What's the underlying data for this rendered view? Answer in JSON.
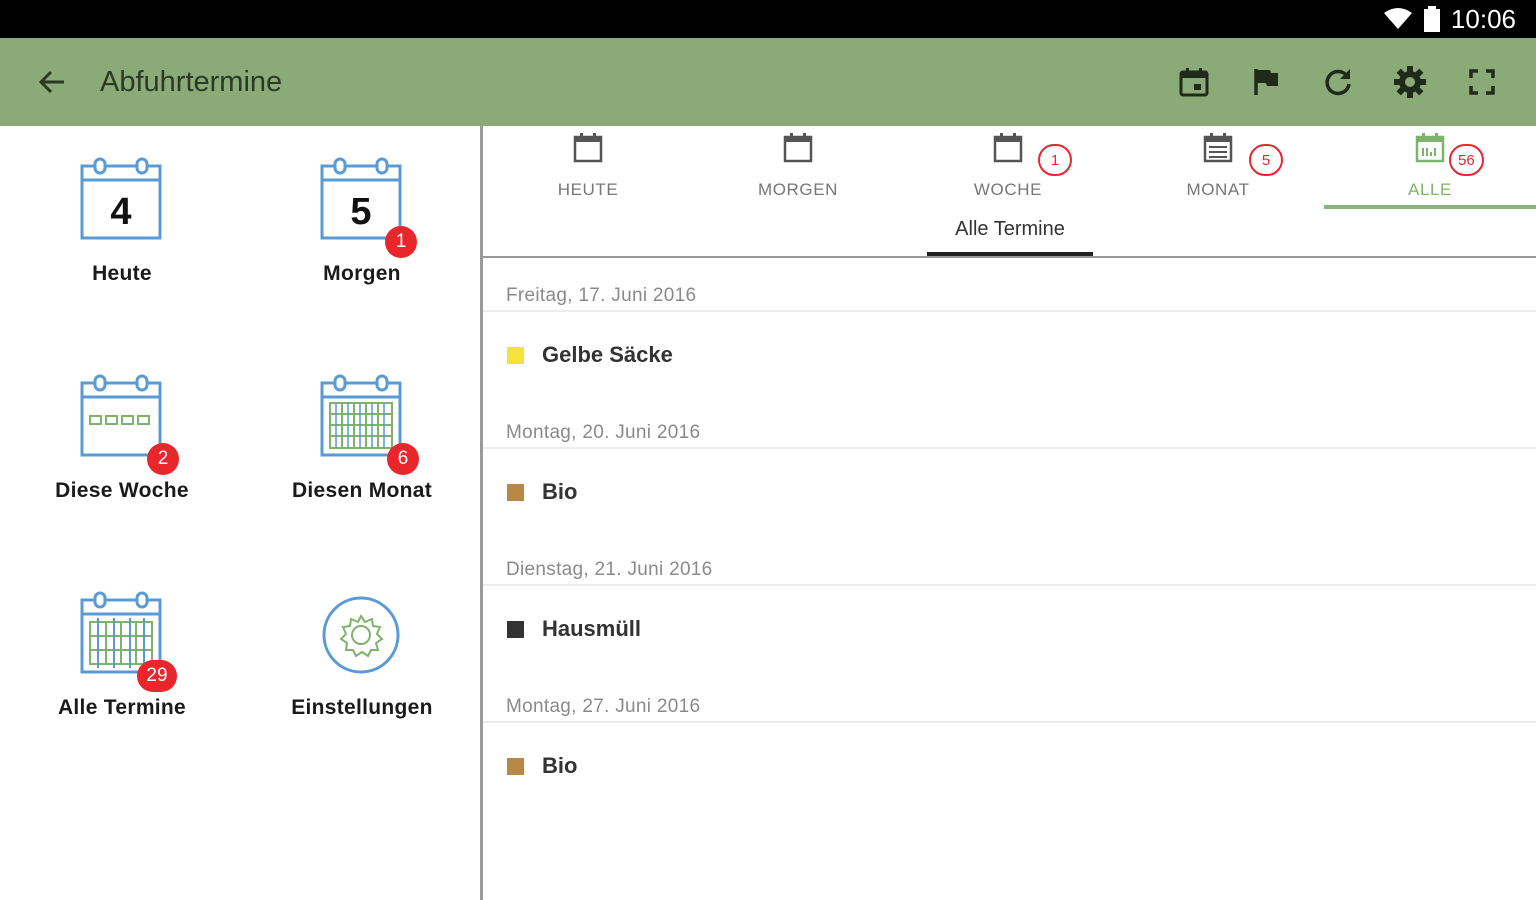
{
  "statusbar": {
    "time": "10:06",
    "icons": [
      "wifi-icon",
      "battery-icon"
    ]
  },
  "appbar": {
    "title": "Abfuhrtermine",
    "back_icon": "arrow-back-icon",
    "actions": [
      "calendar-today-icon",
      "flag-icon",
      "refresh-icon",
      "settings-icon",
      "fullscreen-icon"
    ],
    "color": "#8aab78"
  },
  "dashboard": {
    "tiles": [
      {
        "label": "Heute",
        "day": "4",
        "icon": "calendar-day-icon"
      },
      {
        "label": "Morgen",
        "day": "5",
        "badge": "1",
        "icon": "calendar-day-icon"
      },
      {
        "label": "Diese Woche",
        "badge": "2",
        "icon": "calendar-week-icon"
      },
      {
        "label": "Diesen Monat",
        "badge": "6",
        "icon": "calendar-month-icon"
      },
      {
        "label": "Alle Termine",
        "badge": "29",
        "icon": "calendar-all-icon"
      },
      {
        "label": "Einstellungen",
        "icon": "gear-icon"
      }
    ]
  },
  "tabs": [
    {
      "label": "HEUTE",
      "icon": "calendar-icon"
    },
    {
      "label": "MORGEN",
      "icon": "calendar-icon"
    },
    {
      "label": "WOCHE",
      "badge": "1",
      "icon": "calendar-icon"
    },
    {
      "label": "MONAT",
      "badge": "5",
      "icon": "calendar-month-icon"
    },
    {
      "label": "ALLE",
      "badge": "56",
      "icon": "calendar-all-icon",
      "active": true
    }
  ],
  "subtab": {
    "label": "Alle Termine"
  },
  "schedule": [
    {
      "date": "Freitag, 17. Juni 2016",
      "item": "Gelbe Säcke",
      "color": "#f5e23a"
    },
    {
      "date": "Montag, 20. Juni 2016",
      "item": "Bio",
      "color": "#b88846"
    },
    {
      "date": "Dienstag, 21. Juni 2016",
      "item": "Hausmüll",
      "color": "#333333"
    },
    {
      "date": "Montag, 27. Juni 2016",
      "item": "Bio",
      "color": "#b88846"
    }
  ],
  "colors": {
    "accent": "#8bb47b",
    "badge": "#e8262b"
  }
}
